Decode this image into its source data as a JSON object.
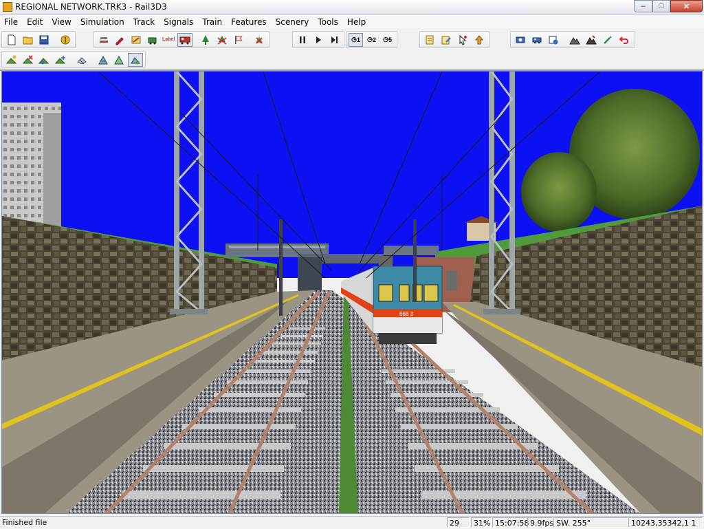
{
  "window": {
    "title": "REGIONAL NETWORK.TRK3 - Rail3D3",
    "minimize": "–",
    "maximize": "□",
    "close": "✕"
  },
  "menu": [
    "File",
    "Edit",
    "View",
    "Simulation",
    "Track",
    "Signals",
    "Train",
    "Features",
    "Scenery",
    "Tools",
    "Help"
  ],
  "toolbar_labels": {
    "label_tool": "Label",
    "speed1": "1",
    "speed2": "2",
    "speed5": "5"
  },
  "status": {
    "message": "Finished file",
    "count": "29",
    "zoom": "31%",
    "time": "15:07:58",
    "fps": "9.9fps",
    "heading": "SW. 255°",
    "coords": "10243,35342,1 1"
  },
  "train": {
    "number": "668 3"
  },
  "colors": {
    "sky": "#0c10f2",
    "grass": "#4f9a3c",
    "platform": "#9b9482",
    "platform_line": "#e2c21c",
    "ballast": "#8f9096",
    "rail": "#b3826a",
    "train_body": "#3c8aa6",
    "train_stripe": "#e04416"
  }
}
